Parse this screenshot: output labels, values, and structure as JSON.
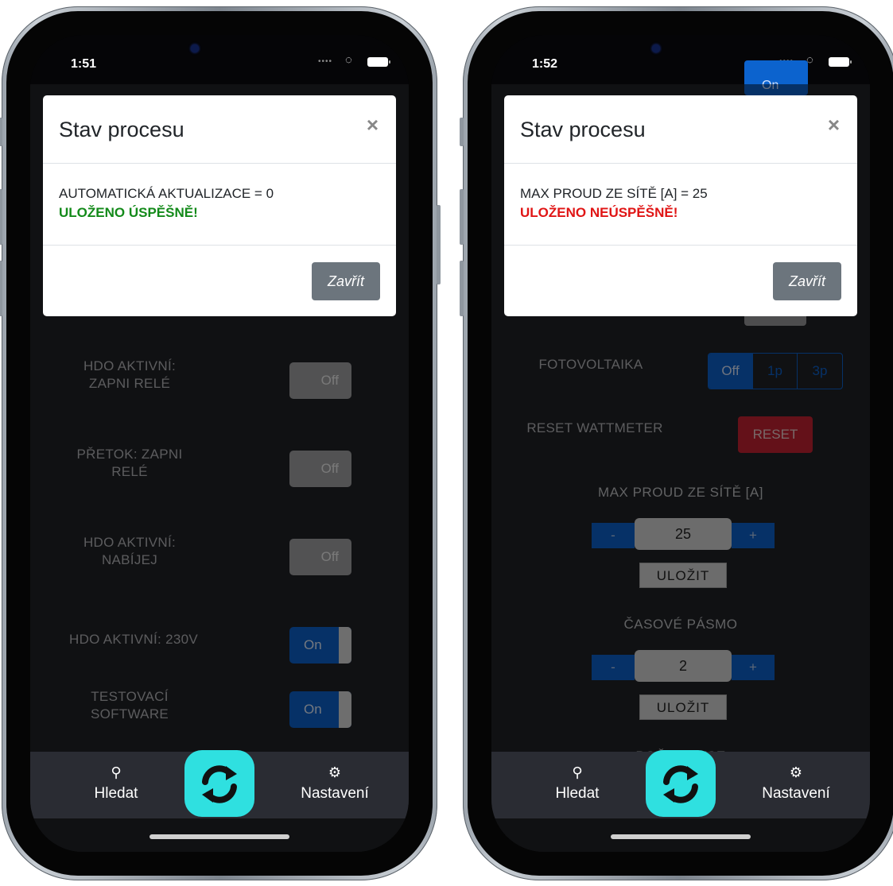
{
  "left": {
    "time": "1:51",
    "modal": {
      "title": "Stav procesu",
      "close_icon": "×",
      "message": "AUTOMATICKÁ AKTUALIZACE = 0",
      "status": "ULOŽENO ÚSPĚŠNĚ!",
      "status_color": "#138a1a",
      "button": "Zavřít"
    },
    "settings": [
      {
        "label": "HDO AKTIVNÍ: ZAPNI RELÉ",
        "toggle": "Off"
      },
      {
        "label": "PŘETOK: ZAPNI RELÉ",
        "toggle": "Off"
      },
      {
        "label": "HDO AKTIVNÍ: NABÍJEJ",
        "toggle": "Off"
      },
      {
        "label": "HDO AKTIVNÍ: 230V",
        "toggle": "On"
      },
      {
        "label": "TESTOVACÍ SOFTWARE",
        "toggle": "On"
      }
    ],
    "tabbar": {
      "search": "Hledat",
      "settings": "Nastavení",
      "search_icon": "search-icon",
      "settings_icon": "gear-icon",
      "refresh_icon": "refresh-icon"
    }
  },
  "right": {
    "time": "1:52",
    "top_toggle": "On",
    "modal": {
      "title": "Stav procesu",
      "close_icon": "×",
      "message": "MAX PROUD ZE SÍTĚ [A] = 25",
      "status": "ULOŽENO NEÚSPĚŠNĚ!",
      "status_color": "#e01515",
      "button": "Zavřít"
    },
    "photovoltaics": {
      "label": "FOTOVOLTAIKA",
      "options": [
        "Off",
        "1p",
        "3p"
      ],
      "selected": "Off"
    },
    "reset": {
      "label": "RESET WATTMETER",
      "button": "RESET"
    },
    "max_current": {
      "label": "MAX PROUD ZE SÍTĚ [A]",
      "minus": "-",
      "value": "25",
      "plus": "+",
      "save": "ULOŽIT"
    },
    "timezone": {
      "label": "ČASOVÉ PÁSMO",
      "minus": "-",
      "value": "2",
      "plus": "+",
      "save": "ULOŽIT"
    },
    "evse_count": {
      "label": "POČET EVSE"
    },
    "tabbar": {
      "search": "Hledat",
      "settings": "Nastavení"
    }
  },
  "colors": {
    "accent_blue": "#0c63ce",
    "refresh_cyan": "#2fe0e0",
    "danger": "#c82333"
  }
}
